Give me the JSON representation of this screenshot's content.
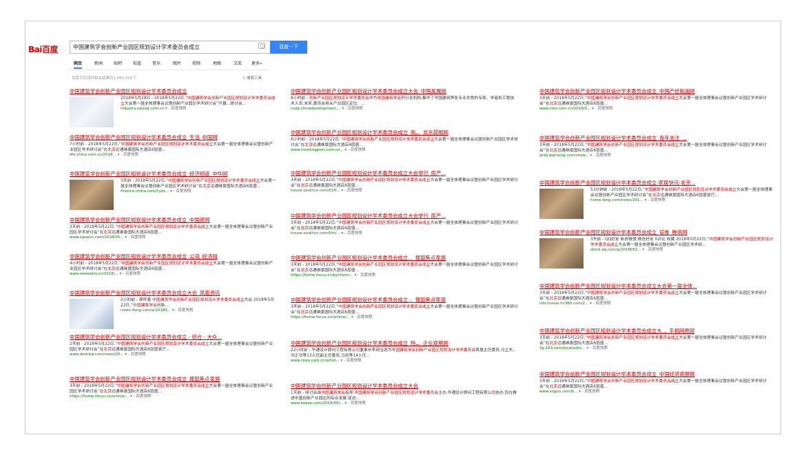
{
  "search": {
    "logo": "Bai百度",
    "query": "中国建筑学会创新产业园区规划设计学术委员会成立",
    "button": "百度一下"
  },
  "tabs": [
    "网页",
    "新闻",
    "贴吧",
    "知道",
    "音乐",
    "图片",
    "视频",
    "地图",
    "文库",
    "更多»"
  ],
  "result_count": "百度为您找到相关结果约1,460,000个",
  "search_tools": "搜索工具",
  "snapshot_label": "百度快照",
  "colors": {
    "title": "#cc0000",
    "highlight": "#cc0000",
    "url": "#007a00",
    "button": "#3385ff"
  },
  "col1": [
    {
      "title": "中国建筑学会创新产业园区规划设计学术委员会成立",
      "image": true,
      "snippet": "2018年5月28日 - 2018年5月22日,“中国建筑学会创新产业园区规划设计学术委员会成立大会第一届全体理事会议暨创新产业园区学术研讨会”开幕...研讨会...",
      "url": "industry.caijing.com.cn"
    },
    {
      "title": "中国建筑学会创新产业园区规划设计学术委员会成立_生活_中国网",
      "snippet": "7小时前 - 2018年5月22日,“中国建筑学会创新产业园区规划设计学术委员会成立大会第一届全体理事会议暨创新产业园区学术研讨会”在北京远通维景国际大酒店6层盛...",
      "url": "life.china.com.cn/2018..."
    },
    {
      "title": "中国建筑学会创新产业园区规划设计学术委员会成立_经济频道_中华网",
      "image": true,
      "snippet": "3天前 - 2018年5月22日,“中国建筑学会创新产业园区规划设计学术委员会成立大会第一届全体理事会议暨创新产业园区学术研讨会”在北京远通维景国际大酒店6层盛...",
      "url": "finance.china.com/hyzx..."
    },
    {
      "title": "中国建筑学会创新产业园区规划设计学术委员会成立_中国商网",
      "snippet": "3天前 - 2018年5月22日,“中国建筑学会创新产业园区规划设计学术委员会成立大会第一届全体理事会议暨创新产业园区学术研讨会”在北京远通维景国际大酒店6层盛...",
      "url": "www.zgswcn.com/2018/05..."
    },
    {
      "title": "中国建筑学会创新产业园区规划设计学术委员会成立_公司_经济网",
      "snippet": "4小时前 - 2018年5月22日,“中国建筑学会创新产业园区规划设计学术委员会成立大会第一届全体理事会议暨创新产业园区学术研讨会”在北京远通维景国际大酒店6层盛...",
      "url": "www.ceweekly.cn/2018/..."
    },
    {
      "title": "中国建筑学会创新产业园区规划设计学术委员会成立大会_凤凰资讯",
      "image": true,
      "snippet": "2小时前 - 摩杯善 中国建筑学会创新产业园区规划设计学术委员会成立大会 2018年5月22日,“中国建筑学会创新...",
      "url": "news.ifeng.com/a/20180..."
    },
    {
      "title": "中国建筑学会创新产业园区规划设计学术委员会成立 - 综合 - 大众...",
      "snippet": "2天前 - 2018年5月22日,“中国建筑学会创新产业园区规划设计学术委员会成立大会第一届全体理事会议暨创新产业园区学术研讨会”在北京远通维景国际大酒店6层盛宴厅...",
      "url": "www.dzshbw.com/news/20..."
    },
    {
      "title": "中国建筑学会创新产业园区规划设计学术委员会成立_搜狐焦点家居",
      "snippet": "3天前 - 2018年5月22日,“中国建筑学会创新产业园区规划设计学术委员会成立大会第一届全体理事会议暨创新产业园区学术研讨会”在北京远通维景国际大酒店6层盛...",
      "url": "https://home.focus.cn/article/..."
    }
  ],
  "col2": [
    {
      "title": "中国建筑学会创新产业园区规划设计学术委员会成立大会_中国发展网",
      "snippet": "8小时前 - 创新产业园区规划设计学术委员会作为中国建筑学会的分支机构,集中了中国建筑界各专业优秀的专家、学者和工程技术人员.未来,委员会将从产业园区定位、...",
      "url": "cxzg.chinadevelopment...."
    },
    {
      "title": "中国建筑学会创新产业园区规划设计学术委员会成立_商..._北京晨报网",
      "snippet": "6小时前 - 2018年5月22日,“中国建筑学会创新产业园区规划设计学术委员会成立大会第一届全体理事会议暨创新产业园区学术研讨会”在北京远通维景国际大酒店6层盛...",
      "url": "www.morningpost.com.cn..."
    },
    {
      "title": "中国建筑学会创新产业园区规划设计学术委员会成立大会举行_房产...",
      "snippet": "3天前 - 2018年5月22日,“中国建筑学会创新产业园区规划设计学术委员会成立大会第一届全体理事会议暨创新产业园区学术研讨会”在北京远通维景国际大酒店6层盛...",
      "url": "house.southcn.com/f/20..."
    },
    {
      "title": "中国建筑学会创新产业园区规划设计学术委员会成立大会举行_房产...",
      "snippet": "3天前 - 2018年5月22日,“中国建筑学会创新产业园区规划设计学术委员会成立大会第一届全体理事会议暨创新产业园区学术研讨会”在北京远通维景国际大酒店6层盛...",
      "url": "house.southcn.com/f/m/..."
    },
    {
      "title": "中国建筑学会创新产业园区规划设计学术委员会成立..._搜狐焦点家居",
      "snippet": "3天前 - 2018年5月22日,“中国建筑学会创新产业园区规划设计学术委员会成立大会第一届全体理事会议暨创新产业园区学术研讨会”在北京远通维景国际大酒店6层盛...",
      "url": "https://home.focus.cn/bj/chann..."
    },
    {
      "title": "中国建筑学会创新产业园区规划设计学术委员会成立..._搜狐焦点家居",
      "snippet": "3天前 - 2018年5月22日,“中国建筑学会创新产业园区规划设计学术委员会成立大会第一届全体理事会议暨创新产业园区学术研讨会”在北京远通维景国际大酒店6层盛...",
      "url": "https://home.focus.cn/article/..."
    },
    {
      "title": "中国建筑学会创新产业园区规划设计学术委员会成立_特..._企业观察网",
      "snippet": "22小时前 - 华通设计顾问工程有限公司董事长李韧当选为中国建筑学会创新产业园区规划设计学术委员会首届主任委员,马立东、冯正功等13人任副主任委员,马尚等14人任...",
      "url": "www.cneo.com.cn/articl..."
    },
    {
      "title": "中国建筑学会创新产业园区规划设计学术委员会成立大会",
      "snippet": "1天前 - 研讨会由中国建筑学会指导,中国建筑学会创新产业园区规划设计学术委员会主办,华通设计顾问工程有限公司协办,旨在推进中国创新产业园区的综合发展.促进...",
      "url": "www.fawan.com/2018/05/..."
    }
  ],
  "col3": [
    {
      "title": "中国建筑学会创新产业园区规划设计学术委员会成立_中国产经新闻网",
      "snippet": "3天前 - 2018年5月22日,“中国建筑学会创新产业园区规划设计学术委员会成立大会第一届全体理事会议暨创新产业园区学术研讨会”在北京远通维景国际大酒店6层盛...",
      "url": "www.cien.com.cn/2018/0..."
    },
    {
      "title": "中国建筑学会创新产业园区规划设计学术委员会成立_青年关注_...",
      "snippet": "3天前 - 2018年5月22日,“中国建筑学会创新产业园区规划设计学术委员会成立大会第一届全体理事会议暨创新产业园区学术研讨会”在北京远通维景国际大酒店6层盛...",
      "url": "qndj.qianlong.com/show..."
    },
    {
      "title": "中国建筑学会创新产业园区规划设计学术委员会成立-家居快讯-北京...",
      "image": true,
      "snippet": "53分钟前 - 2018年5月22日,“中国建筑学会创新产业园区规划设计学术委员会成立大会第一届全体理事会议暨创新产业园区学术研讨会”在北京远通维景国际大酒店6层盛宴厅...",
      "url": "home.fang.com/news/201..."
    },
    {
      "title": "中国建筑学会创新产业园区规划设计学术委员会成立_证券_腾讯网",
      "image": true,
      "snippet": "3天前 - QQ好友 新浪微博 微信好友 0评论 收藏 2018年5月22日,“中国建筑学会创新产业园区规划设计学术委员会成立大会第一届全体理事会议暨创新产业园区学术研...",
      "url": "stock.qq.com/a/2018052..."
    },
    {
      "title": "中国建筑学会创新产业园区规划设计学术委员会成立大会第一届全体...",
      "snippet": "3天前 - 2018年5月22日,“中国建筑学会创新产业园区规划设计学术委员会成立大会第一届全体理事会议暨创新产业园区学术研讨会”在北京远通维景国际大酒店6层盛...",
      "url": "info.house.hc360.com/2..."
    },
    {
      "title": "中国建筑学会创新产业园区规划设计学术委员会成立大..._手机网易网",
      "snippet": "3天前 - 2018年5月22日,“中国建筑学会创新产业园区规划设计学术委员会成立大会第一届全体理事会议暨创新产业园区学术研讨会”在北京远通维景国际大酒店6层盛...",
      "url": "3g.163.com/local/artic..."
    },
    {
      "title": "中国建筑学会创新产业园区规划设计学术委员会成立_中国经济观察网",
      "snippet": "3天前 - 2018年5月22日,“中国建筑学会创新产业园区规划设计学术委员会成立大会第一届全体理事会议暨创新产业园区学术研讨会”在北京远通维景国际大酒店6层盛...",
      "url": "www.xsgou.com/b..."
    }
  ]
}
